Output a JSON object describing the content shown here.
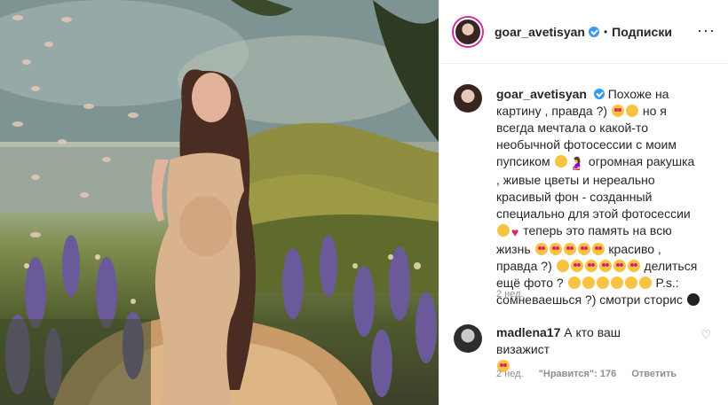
{
  "post": {
    "username": "goar_avetisyan",
    "separator": "•",
    "follow_label": "Подписки",
    "more_label": "···"
  },
  "caption": {
    "username": "goar_avetisyan",
    "t1": "Похоже на картину , правда ?)",
    "t2": "но я всегда мечтала о какой-то необычной фотосессии с моим пупсиком",
    "t3": "огромная ракушка , живые цветы и нереально красивый фон - созданный специально для этой фотосессии",
    "t4": "теперь это память на всю жизнь",
    "t5": "красиво , правда ?)",
    "t6": "делиться ещё фото ?",
    "t7": "P.s.: сомневаешься ?) смотри сторис",
    "time": "2 нед."
  },
  "comment": {
    "username": "madlena17",
    "text": "А кто ваш визажист",
    "time": "2 нед.",
    "likes": "\"Нравится\": 176",
    "reply": "Ответить"
  },
  "icons": {
    "verified": "verified-badge-icon",
    "like": "heart-outline-icon"
  }
}
